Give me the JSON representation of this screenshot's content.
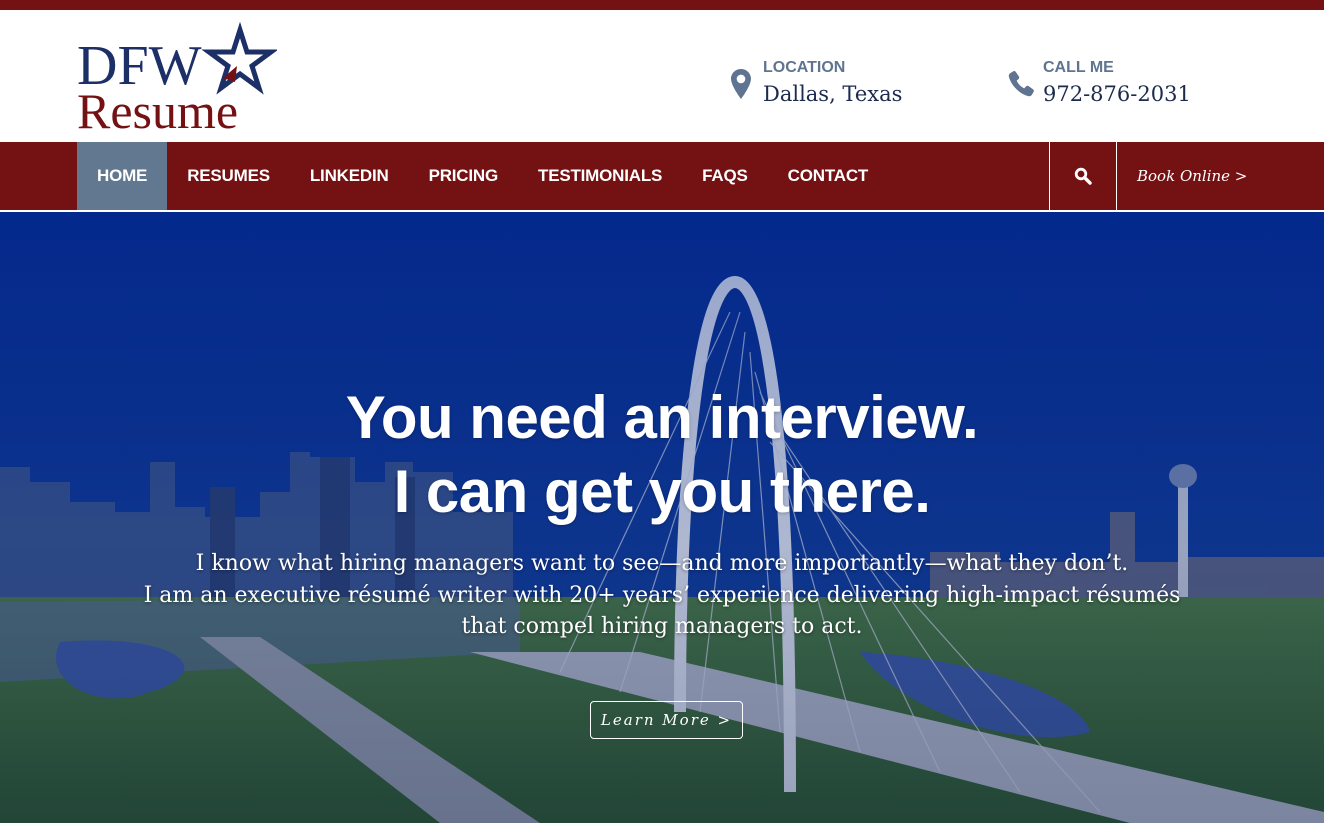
{
  "brand": {
    "logo_line1": "DFW",
    "logo_line2": "Resume",
    "colors": {
      "maroon": "#741112",
      "navy": "#1c2f66",
      "slate": "#627890"
    }
  },
  "header": {
    "location": {
      "icon": "map-pin-icon",
      "label": "LOCATION",
      "value": "Dallas, Texas"
    },
    "phone": {
      "icon": "phone-icon",
      "label": "CALL ME",
      "value": "972-876-2031"
    }
  },
  "nav": {
    "items": [
      {
        "label": "HOME",
        "active": true
      },
      {
        "label": "RESUMES",
        "active": false
      },
      {
        "label": "LINKEDIN",
        "active": false
      },
      {
        "label": "PRICING",
        "active": false
      },
      {
        "label": "TESTIMONIALS",
        "active": false
      },
      {
        "label": "FAQS",
        "active": false
      },
      {
        "label": "CONTACT",
        "active": false
      }
    ],
    "search_icon": "search-icon",
    "book_label": "Book Online >"
  },
  "hero": {
    "title_line1": "You need an interview.",
    "title_line2": "I can get you there.",
    "subtitle_lines": [
      "I know what hiring managers want to see—and more importantly—what they don’t.",
      "I am an executive résumé writer with 20+ years’ experience delivering high-impact résumés",
      "that compel hiring managers to act."
    ],
    "cta_label": "Learn More >",
    "background": "dallas-skyline-bridge-photo"
  }
}
